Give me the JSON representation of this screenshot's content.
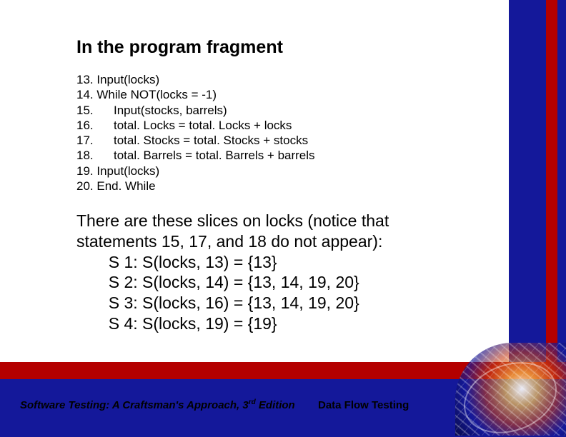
{
  "heading": "In the program fragment",
  "code": "13. Input(locks)\n14. While NOT(locks = -1)\n15.      Input(stocks, barrels)\n16.      total. Locks = total. Locks + locks\n17.      total. Stocks = total. Stocks + stocks\n18.      total. Barrels = total. Barrels + barrels\n19. Input(locks)\n20. End. While",
  "body": "There are these slices on locks (notice that\nstatements 15, 17, and 18 do not appear):\n       S 1: S(locks, 13) = {13}\n       S 2: S(locks, 14) = {13, 14, 19, 20}\n       S 3: S(locks, 16) = {13, 14, 19, 20}\n       S 4: S(locks, 19) = {19}",
  "footer": {
    "left_pre": "Software Testing: A Craftsman's Approach, 3",
    "left_sup": "rd",
    "left_post": " Edition",
    "right": "Data Flow Testing"
  }
}
